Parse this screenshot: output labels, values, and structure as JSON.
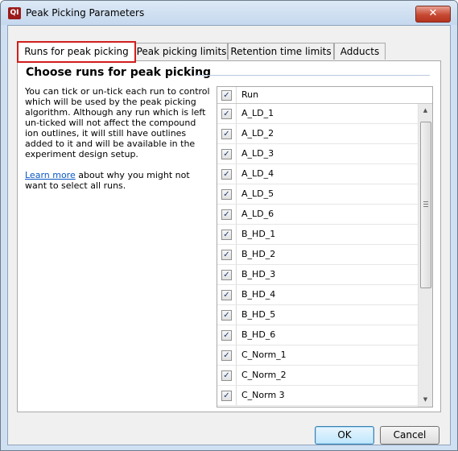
{
  "window": {
    "title": "Peak Picking Parameters",
    "app_icon_text": "QI",
    "close_glyph": "✕"
  },
  "tabs": [
    {
      "label": "Runs for peak picking",
      "active": true
    },
    {
      "label": "Peak picking limits",
      "active": false
    },
    {
      "label": "Retention time limits",
      "active": false
    },
    {
      "label": "Adducts",
      "active": false
    }
  ],
  "panel": {
    "heading": "Choose runs for peak picking",
    "description": "You can tick or un-tick each run to control which will be used by the peak picking algorithm. Although any run which is left un-ticked will not affect the compound ion outlines, it will still have outlines added to it and will be available in the experiment design setup.",
    "learn_more_link": "Learn more",
    "learn_more_rest": " about why you might not want to select all runs."
  },
  "grid": {
    "header": {
      "label": "Run",
      "checked": true
    },
    "rows": [
      {
        "label": "A_LD_1",
        "checked": true
      },
      {
        "label": "A_LD_2",
        "checked": true
      },
      {
        "label": "A_LD_3",
        "checked": true
      },
      {
        "label": "A_LD_4",
        "checked": true
      },
      {
        "label": "A_LD_5",
        "checked": true
      },
      {
        "label": "A_LD_6",
        "checked": true
      },
      {
        "label": "B_HD_1",
        "checked": true
      },
      {
        "label": "B_HD_2",
        "checked": true
      },
      {
        "label": "B_HD_3",
        "checked": true
      },
      {
        "label": "B_HD_4",
        "checked": true
      },
      {
        "label": "B_HD_5",
        "checked": true
      },
      {
        "label": "B_HD_6",
        "checked": true
      },
      {
        "label": "C_Norm_1",
        "checked": true
      },
      {
        "label": "C_Norm_2",
        "checked": true
      },
      {
        "label": "C_Norm 3",
        "checked": true
      }
    ],
    "check_glyph": "✓"
  },
  "buttons": {
    "ok": "OK",
    "cancel": "Cancel"
  },
  "colors": {
    "active_tab_outline": "#d21e1e",
    "link": "#0a57c2"
  }
}
